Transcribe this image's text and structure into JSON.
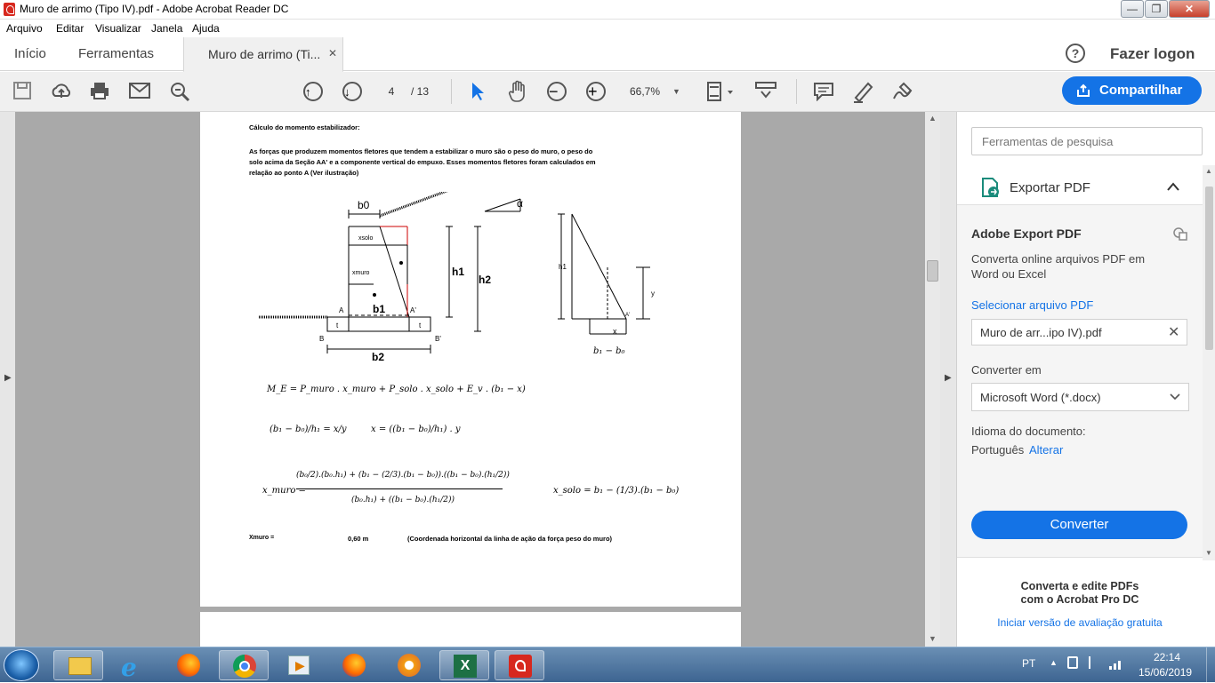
{
  "window": {
    "title": "Muro de arrimo (Tipo IV).pdf - Adobe Acrobat Reader DC",
    "minimize": "—",
    "maximize": "❐",
    "close": "✕"
  },
  "menu": [
    "Arquivo",
    "Editar",
    "Visualizar",
    "Janela",
    "Ajuda"
  ],
  "tabs": {
    "home": "Início",
    "tools": "Ferramentas",
    "doc": "Muro de arrimo (Ti...",
    "close": "✕"
  },
  "header": {
    "help": "?",
    "login": "Fazer logon"
  },
  "toolbar": {
    "page_current": "4",
    "page_total": "/ 13",
    "zoom": "66,7%",
    "share": "Compartilhar"
  },
  "panel": {
    "search_placeholder": "Ferramentas de pesquisa",
    "export_title": "Exportar PDF",
    "section_title": "Adobe Export PDF",
    "desc": "Converta online arquivos PDF em Word ou Excel",
    "select_file": "Selecionar arquivo PDF",
    "file_name": "Muro de arr...ipo IV).pdf",
    "convert_to_label": "Converter em",
    "convert_to_value": "Microsoft Word (*.docx)",
    "lang_label": "Idioma do documento:",
    "lang_value": "Português",
    "lang_change": "Alterar",
    "convert_btn": "Converter",
    "promo_line1": "Converta e edite PDFs",
    "promo_line2": "com o Acrobat Pro DC",
    "trial": "Iniciar versão de avaliação gratuita"
  },
  "document": {
    "heading": "Cálculo do momento estabilizador:",
    "para1": "As forças que produzem momentos fletores que tendem a estabilizar o muro são o peso do muro, o peso do",
    "para2": "solo acima da Seção AA' e a componente vertical do empuxo. Esses momentos fletores foram calculados em",
    "para3": "relação ao ponto A (Ver ilustração)",
    "fig": {
      "b0": "b0",
      "alpha": "α",
      "xsolo": "xsolo",
      "xmuro": "xmuro",
      "h1": "h1",
      "h2": "h2",
      "A": "A",
      "b1": "b1",
      "Ap": "A'",
      "t1": "t",
      "t2": "t",
      "B": "B",
      "Bp": "B'",
      "b2": "b2",
      "h1b": "h1",
      "y": "y",
      "Ap2": "A'",
      "x": "x",
      "b1b0": "b₁ − b₀"
    },
    "eq1": "M_E = P_muro . x_muro + P_solo . x_solo + E_v . (b₁ − x)",
    "eq2a": "(b₁ − b₀)/h₁ = x/y",
    "eq2b": "x = ((b₁ − b₀)/h₁) . y",
    "eq3a_lhs": "x_muro =",
    "eq3a_num": "(b₀/2).(b₀.h₁) + (b₁ − (2/3).(b₁ − b₀)).((b₁ − b₀).(h₁/2))",
    "eq3a_den": "(b₀.h₁) + ((b₁ − b₀).(h₁/2))",
    "eq3b": "x_solo = b₁ − (1/3).(b₁ − b₀)",
    "result_label": "Xmuro =",
    "result_value": "0,60  m",
    "result_note": "(Coordenada horizontal da linha de ação da força peso do muro)"
  },
  "tray": {
    "lang": "PT",
    "time": "22:14",
    "date": "15/06/2019"
  }
}
